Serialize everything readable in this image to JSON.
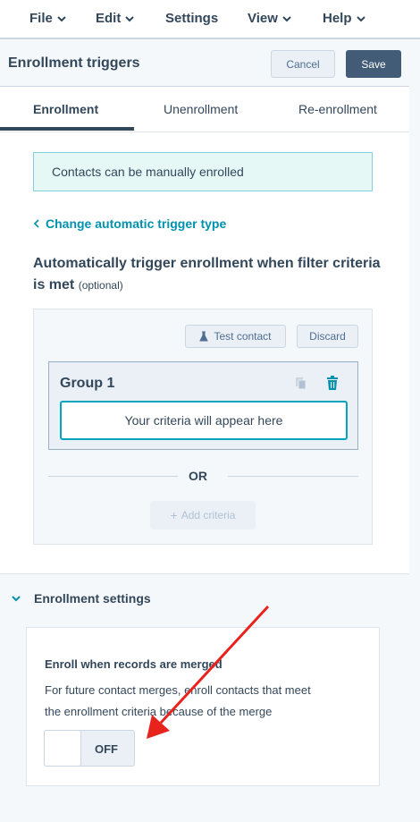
{
  "menu": {
    "items": [
      "File",
      "Edit",
      "Settings",
      "View",
      "Help"
    ]
  },
  "header": {
    "title": "Enrollment triggers",
    "cancel_label": "Cancel",
    "save_label": "Save"
  },
  "tabs": [
    "Enrollment",
    "Unenrollment",
    "Re-enrollment"
  ],
  "info_box": "Contacts can be manually enrolled",
  "back_link": "Change automatic trigger type",
  "heading": {
    "text": "Automatically trigger enrollment when filter criteria is met",
    "optional": "(optional)"
  },
  "filter": {
    "test_contact_label": "Test contact",
    "discard_label": "Discard",
    "group_title": "Group 1",
    "criteria_placeholder": "Your criteria will appear here",
    "or_label": "OR",
    "add_criteria_label": "Add criteria"
  },
  "settings": {
    "header": "Enrollment settings",
    "merge_title": "Enroll when records are merged",
    "merge_desc_line1": "For future contact merges, enroll contacts that meet",
    "merge_desc_line2": "the enrollment criteria because of the merge",
    "toggle_state": "OFF"
  },
  "colors": {
    "accent": "#0091ae",
    "primary_button": "#425b76",
    "annotation_arrow": "#e8231e"
  }
}
